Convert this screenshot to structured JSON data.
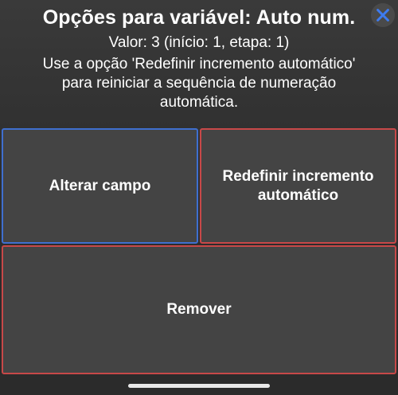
{
  "dialog": {
    "title": "Opções para variável: Auto num.",
    "value_line": "Valor: 3 (início: 1, etapa: 1)",
    "description": "Use a opção 'Redefinir incremento automático' para reiniciar a sequência de numeração automática."
  },
  "buttons": {
    "change_field": "Alterar campo",
    "reset_increment": "Redefinir incremento automático",
    "remove": "Remover"
  },
  "icons": {
    "close": "close-icon"
  },
  "colors": {
    "close_icon": "#3d7bf0",
    "border_blue": "#3f6fcf",
    "border_red": "#c84848",
    "button_bg": "#444444"
  }
}
